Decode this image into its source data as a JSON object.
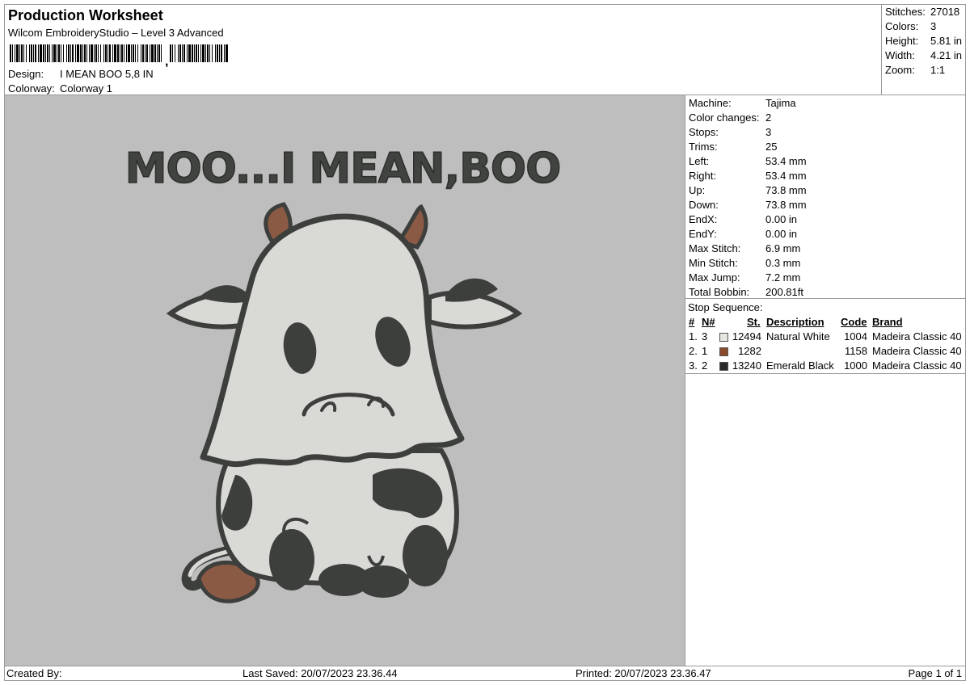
{
  "header": {
    "title": "Production Worksheet",
    "software": "Wilcom EmbroideryStudio – Level 3 Advanced",
    "barcode_text": ",",
    "design_label": "Design:",
    "design_value": "I MEAN BOO 5,8 IN",
    "colorway_label": "Colorway:",
    "colorway_value": "Colorway 1"
  },
  "summary": [
    {
      "label": "Stitches:",
      "value": "27018"
    },
    {
      "label": "Colors:",
      "value": "3"
    },
    {
      "label": "Height:",
      "value": "5.81 in"
    },
    {
      "label": "Width:",
      "value": "4.21 in"
    },
    {
      "label": "Zoom:",
      "value": "1:1"
    }
  ],
  "design_text": "MOO...I MEAN,BOO",
  "machine_info": [
    {
      "label": "Machine:",
      "value": "Tajima"
    },
    {
      "label": "Color changes:",
      "value": "2"
    },
    {
      "label": "Stops:",
      "value": "3"
    },
    {
      "label": "Trims:",
      "value": "25"
    },
    {
      "label": "Left:",
      "value": "53.4 mm"
    },
    {
      "label": "Right:",
      "value": "53.4 mm"
    },
    {
      "label": "Up:",
      "value": "73.8 mm"
    },
    {
      "label": "Down:",
      "value": "73.8 mm"
    },
    {
      "label": "EndX:",
      "value": "0.00 in"
    },
    {
      "label": "EndY:",
      "value": "0.00 in"
    },
    {
      "label": "Max Stitch:",
      "value": "6.9 mm"
    },
    {
      "label": "Min Stitch:",
      "value": "0.3 mm"
    },
    {
      "label": "Max Jump:",
      "value": "7.2 mm"
    },
    {
      "label": "Total Bobbin:",
      "value": "200.81ft"
    }
  ],
  "stop_sequence": {
    "title": "Stop Sequence:",
    "headers": {
      "num": "#",
      "n": "N#",
      "st": "St.",
      "description": "Description",
      "code": "Code",
      "brand": "Brand"
    },
    "rows": [
      {
        "num": "1.",
        "n": "3",
        "color": "#e6e6e3",
        "st": "12494",
        "description": "Natural White",
        "code": "1004",
        "brand": "Madeira Classic 40"
      },
      {
        "num": "2.",
        "n": "1",
        "color": "#8a4a2c",
        "st": "1282",
        "description": "",
        "code": "1158",
        "brand": "Madeira Classic 40"
      },
      {
        "num": "3.",
        "n": "2",
        "color": "#2a2a2a",
        "st": "13240",
        "description": "Emerald Black",
        "code": "1000",
        "brand": "Madeira Classic 40"
      }
    ]
  },
  "footer": {
    "created_by": "Created By:",
    "last_saved": "Last Saved: 20/07/2023 23.36.44",
    "printed": "Printed: 20/07/2023 23.36.47",
    "page": "Page 1 of 1"
  },
  "colors": {
    "canvas": "#bebebe",
    "thread_dark": "#3d3f3c",
    "thread_light": "#d9dad5",
    "thread_brown": "#8b5a44"
  }
}
